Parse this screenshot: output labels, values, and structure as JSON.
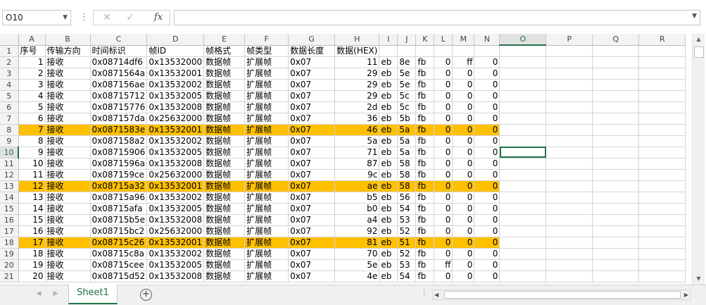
{
  "formula_bar": {
    "name_box": "O10",
    "cancel_icon": "✕",
    "enter_icon": "✓",
    "fx_label": "fx",
    "formula_value": ""
  },
  "columns": [
    "A",
    "B",
    "C",
    "D",
    "E",
    "F",
    "G",
    "H",
    "I",
    "J",
    "K",
    "L",
    "M",
    "N",
    "O",
    "P",
    "Q",
    "R"
  ],
  "active_column": "O",
  "active_row": 10,
  "selected_cell": "O10",
  "highlight_color": "#ffc000",
  "accent_color": "#217346",
  "header_row": [
    "序号",
    "传输方向",
    "时间标识",
    "帧ID",
    "帧格式",
    "帧类型",
    "数据长度",
    "数据(HEX)",
    "",
    "",
    "",
    "",
    "",
    "",
    "",
    "",
    "",
    ""
  ],
  "rows": [
    {
      "n": 2,
      "hl": false,
      "c": [
        "1",
        "接收",
        "0x08714df6",
        "0x13532000",
        "数据帧",
        "扩展帧",
        "0x07",
        "11",
        "eb",
        "8e",
        "fb",
        "0",
        "ff",
        "0",
        "",
        "",
        "",
        ""
      ]
    },
    {
      "n": 3,
      "hl": false,
      "c": [
        "2",
        "接收",
        "0x0871564a",
        "0x13532001",
        "数据帧",
        "扩展帧",
        "0x07",
        "29",
        "eb",
        "5e",
        "fb",
        "0",
        "0",
        "0",
        "",
        "",
        "",
        ""
      ]
    },
    {
      "n": 4,
      "hl": false,
      "c": [
        "3",
        "接收",
        "0x087156ae",
        "0x13532002",
        "数据帧",
        "扩展帧",
        "0x07",
        "29",
        "eb",
        "5e",
        "fb",
        "0",
        "0",
        "0",
        "",
        "",
        "",
        ""
      ]
    },
    {
      "n": 5,
      "hl": false,
      "c": [
        "4",
        "接收",
        "0x08715712",
        "0x13532005",
        "数据帧",
        "扩展帧",
        "0x07",
        "29",
        "eb",
        "5c",
        "fb",
        "0",
        "0",
        "0",
        "",
        "",
        "",
        ""
      ]
    },
    {
      "n": 6,
      "hl": false,
      "c": [
        "5",
        "接收",
        "0x08715776",
        "0x13532008",
        "数据帧",
        "扩展帧",
        "0x07",
        "2d",
        "eb",
        "5c",
        "fb",
        "0",
        "0",
        "0",
        "",
        "",
        "",
        ""
      ]
    },
    {
      "n": 7,
      "hl": false,
      "c": [
        "6",
        "接收",
        "0x087157da",
        "0x25632000",
        "数据帧",
        "扩展帧",
        "0x07",
        "36",
        "eb",
        "5b",
        "fb",
        "0",
        "0",
        "0",
        "",
        "",
        "",
        ""
      ]
    },
    {
      "n": 8,
      "hl": true,
      "c": [
        "7",
        "接收",
        "0x0871583e",
        "0x13532001",
        "数据帧",
        "扩展帧",
        "0x07",
        "46",
        "eb",
        "5a",
        "fb",
        "0",
        "0",
        "0",
        "",
        "",
        "",
        ""
      ]
    },
    {
      "n": 9,
      "hl": false,
      "c": [
        "8",
        "接收",
        "0x087158a2",
        "0x13532002",
        "数据帧",
        "扩展帧",
        "0x07",
        "5a",
        "eb",
        "5a",
        "fb",
        "0",
        "0",
        "0",
        "",
        "",
        "",
        ""
      ]
    },
    {
      "n": 10,
      "hl": false,
      "c": [
        "9",
        "接收",
        "0x08715906",
        "0x13532005",
        "数据帧",
        "扩展帧",
        "0x07",
        "71",
        "eb",
        "5a",
        "fb",
        "0",
        "0",
        "0",
        "",
        "",
        "",
        ""
      ]
    },
    {
      "n": 11,
      "hl": false,
      "c": [
        "10",
        "接收",
        "0x0871596a",
        "0x13532008",
        "数据帧",
        "扩展帧",
        "0x07",
        "87",
        "eb",
        "58",
        "fb",
        "0",
        "0",
        "0",
        "",
        "",
        "",
        ""
      ]
    },
    {
      "n": 12,
      "hl": false,
      "c": [
        "11",
        "接收",
        "0x087159ce",
        "0x25632000",
        "数据帧",
        "扩展帧",
        "0x07",
        "9c",
        "eb",
        "58",
        "fb",
        "0",
        "0",
        "0",
        "",
        "",
        "",
        ""
      ]
    },
    {
      "n": 13,
      "hl": true,
      "c": [
        "12",
        "接收",
        "0x08715a32",
        "0x13532001",
        "数据帧",
        "扩展帧",
        "0x07",
        "ae",
        "eb",
        "58",
        "fb",
        "0",
        "0",
        "0",
        "",
        "",
        "",
        ""
      ]
    },
    {
      "n": 14,
      "hl": false,
      "c": [
        "13",
        "接收",
        "0x08715a96",
        "0x13532002",
        "数据帧",
        "扩展帧",
        "0x07",
        "b5",
        "eb",
        "56",
        "fb",
        "0",
        "0",
        "0",
        "",
        "",
        "",
        ""
      ]
    },
    {
      "n": 15,
      "hl": false,
      "c": [
        "14",
        "接收",
        "0x08715afa",
        "0x13532005",
        "数据帧",
        "扩展帧",
        "0x07",
        "b0",
        "eb",
        "54",
        "fb",
        "0",
        "0",
        "0",
        "",
        "",
        "",
        ""
      ]
    },
    {
      "n": 16,
      "hl": false,
      "c": [
        "15",
        "接收",
        "0x08715b5e",
        "0x13532008",
        "数据帧",
        "扩展帧",
        "0x07",
        "a4",
        "eb",
        "53",
        "fb",
        "0",
        "0",
        "0",
        "",
        "",
        "",
        ""
      ]
    },
    {
      "n": 17,
      "hl": false,
      "c": [
        "16",
        "接收",
        "0x08715bc2",
        "0x25632000",
        "数据帧",
        "扩展帧",
        "0x07",
        "92",
        "eb",
        "52",
        "fb",
        "0",
        "0",
        "0",
        "",
        "",
        "",
        ""
      ]
    },
    {
      "n": 18,
      "hl": true,
      "c": [
        "17",
        "接收",
        "0x08715c26",
        "0x13532001",
        "数据帧",
        "扩展帧",
        "0x07",
        "81",
        "eb",
        "51",
        "fb",
        "0",
        "0",
        "0",
        "",
        "",
        "",
        ""
      ]
    },
    {
      "n": 19,
      "hl": false,
      "c": [
        "18",
        "接收",
        "0x08715c8a",
        "0x13532002",
        "数据帧",
        "扩展帧",
        "0x07",
        "70",
        "eb",
        "52",
        "fb",
        "0",
        "0",
        "0",
        "",
        "",
        "",
        ""
      ]
    },
    {
      "n": 20,
      "hl": false,
      "c": [
        "19",
        "接收",
        "0x08715cee",
        "0x13532005",
        "数据帧",
        "扩展帧",
        "0x07",
        "5e",
        "eb",
        "53",
        "fb",
        "ff",
        "0",
        "0",
        "",
        "",
        "",
        ""
      ]
    },
    {
      "n": 21,
      "hl": false,
      "c": [
        "20",
        "接收",
        "0x08715d52",
        "0x13532008",
        "数据帧",
        "扩展帧",
        "0x07",
        "4e",
        "eb",
        "54",
        "fb",
        "0",
        "0",
        "0",
        "",
        "",
        "",
        ""
      ]
    }
  ],
  "sheet_tabs": [
    "Sheet1"
  ],
  "add_sheet_icon": "+",
  "tab_dots": "⋮"
}
